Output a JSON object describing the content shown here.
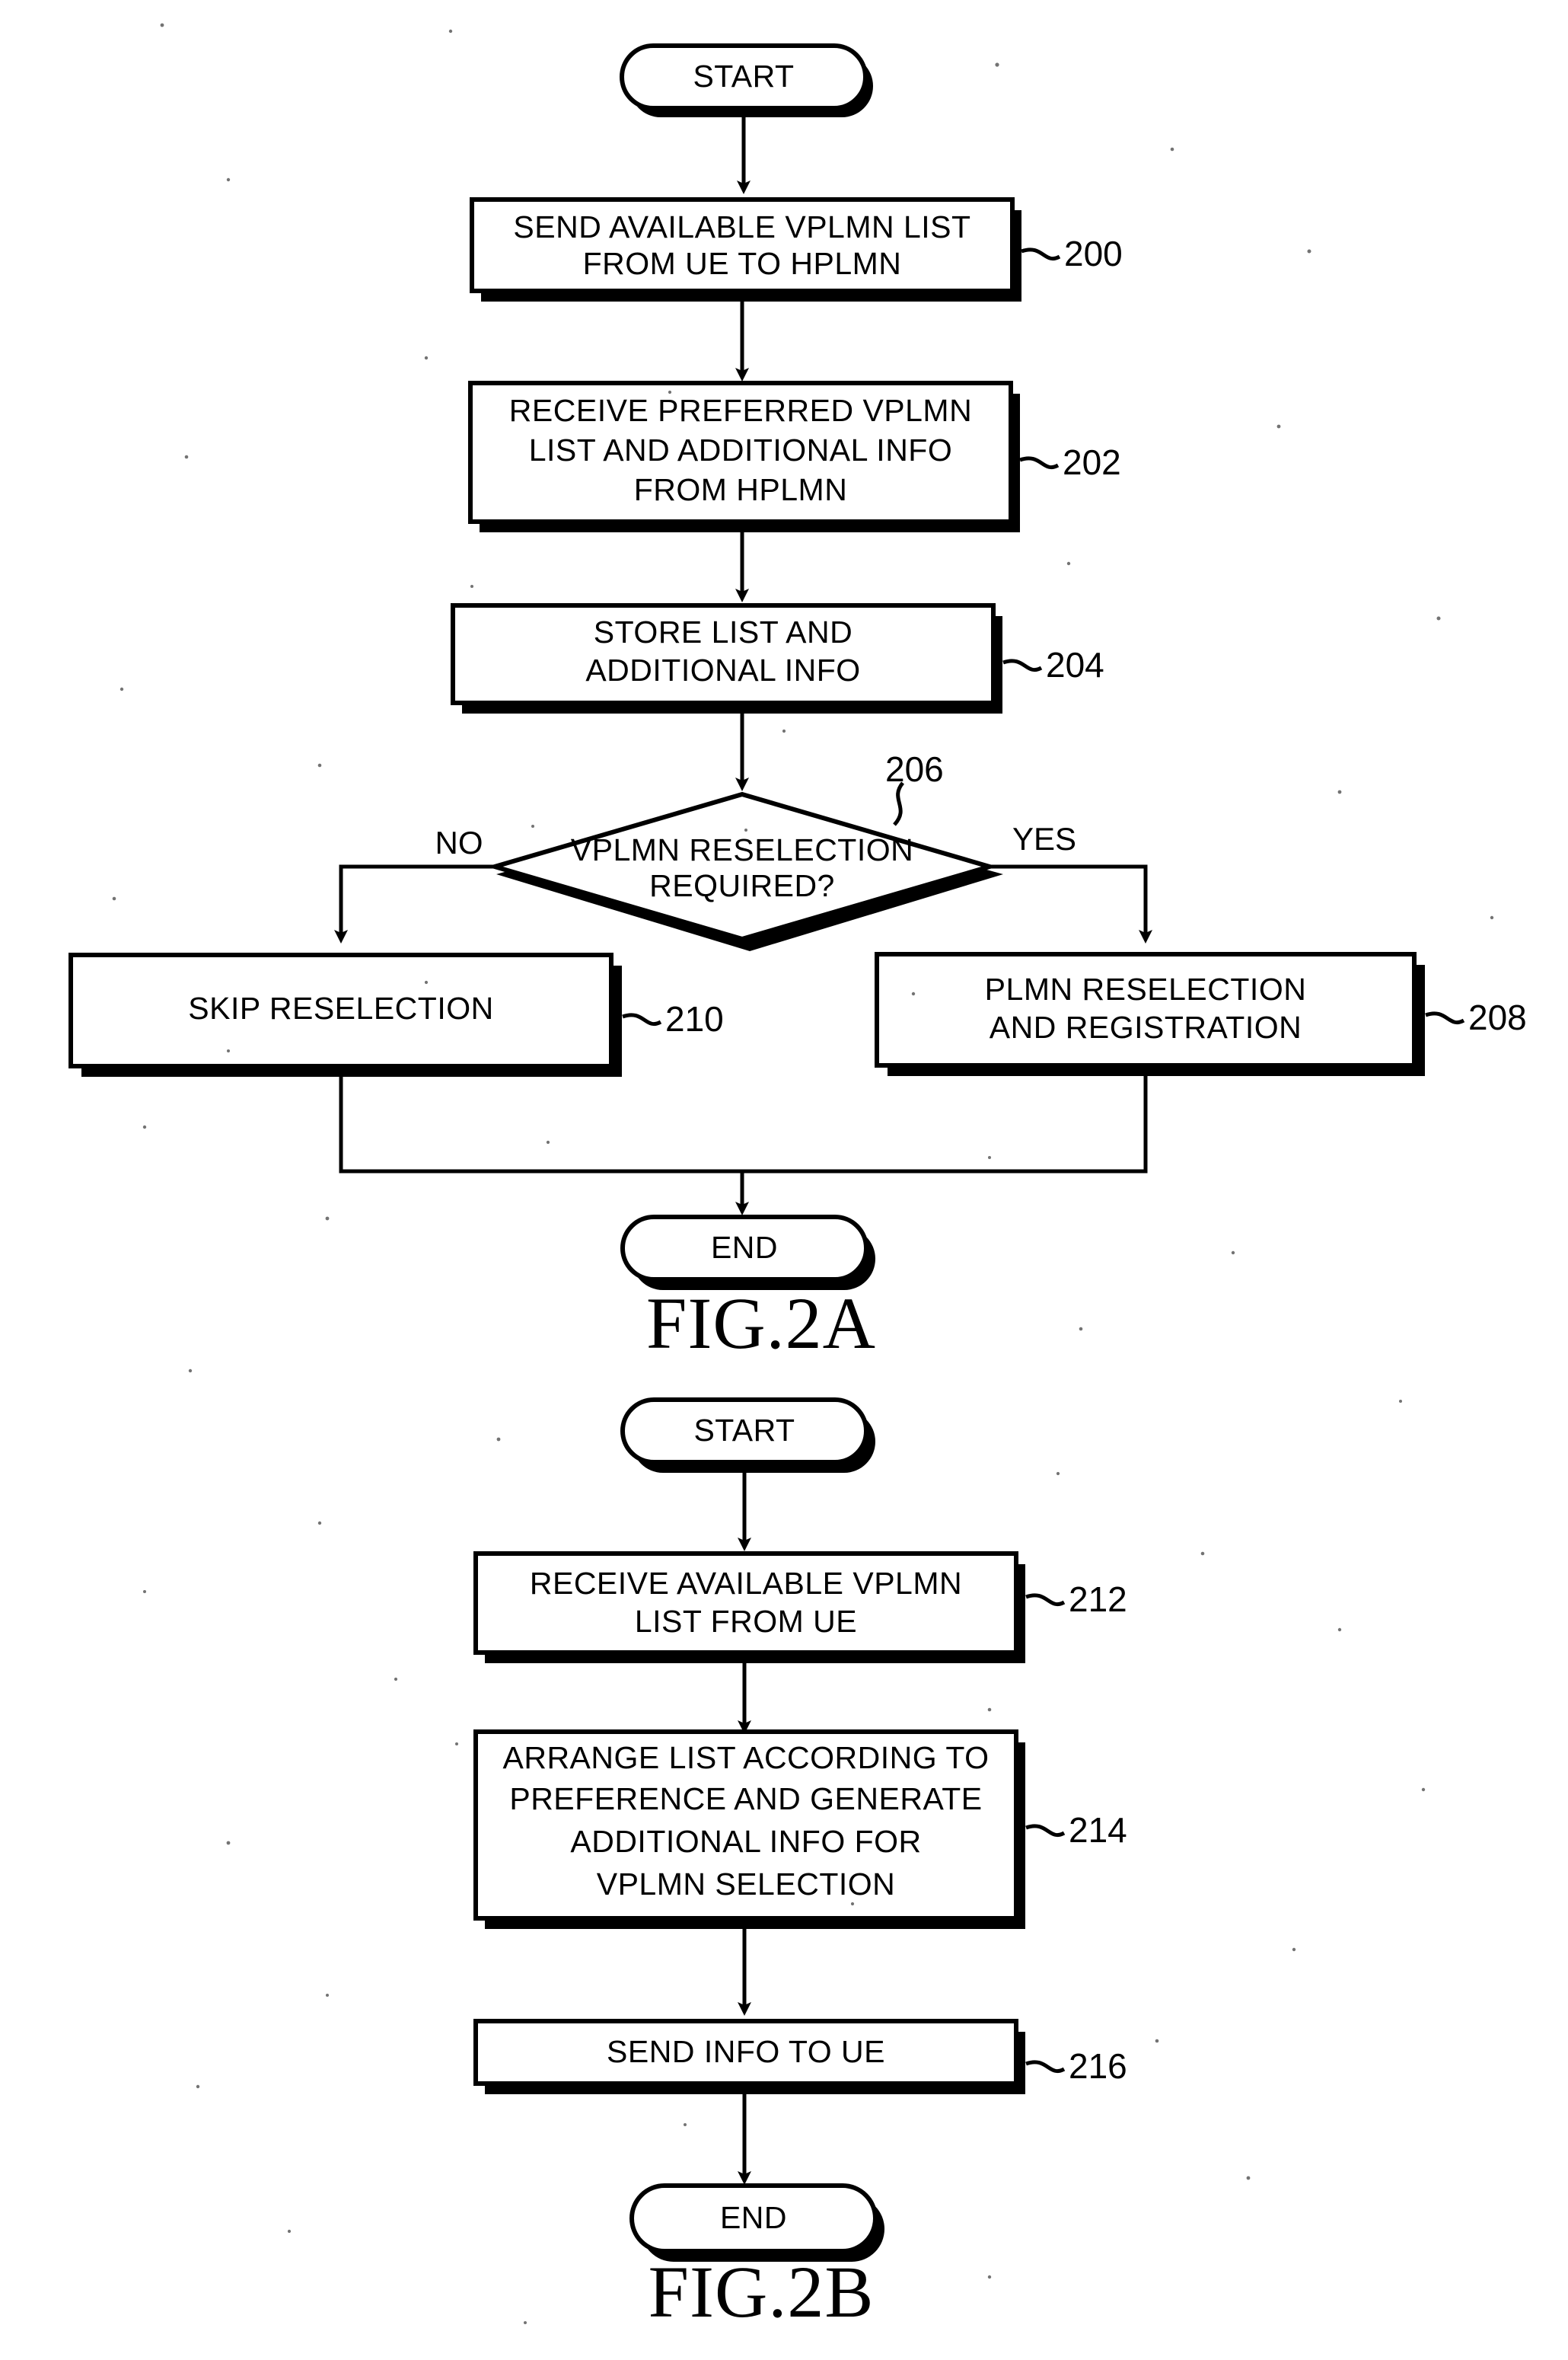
{
  "document": {
    "kind": "patent-flowchart-sheet",
    "figures": [
      {
        "caption": "FIG.2A",
        "nodes": {
          "start": {
            "label": "START"
          },
          "s200": {
            "ref": "200",
            "lines": [
              "SEND AVAILABLE VPLMN LIST",
              "FROM UE TO HPLMN"
            ]
          },
          "s202": {
            "ref": "202",
            "lines": [
              "RECEIVE PREFERRED VPLMN",
              "LIST AND ADDITIONAL INFO",
              "FROM HPLMN"
            ]
          },
          "s204": {
            "ref": "204",
            "lines": [
              "STORE LIST AND",
              "ADDITIONAL INFO"
            ]
          },
          "s206": {
            "ref": "206",
            "lines": [
              "VPLMN RESELECTION",
              "REQUIRED?"
            ],
            "branch_no": "NO",
            "branch_yes": "YES"
          },
          "s210": {
            "ref": "210",
            "lines": [
              "SKIP RESELECTION"
            ]
          },
          "s208": {
            "ref": "208",
            "lines": [
              "PLMN RESELECTION",
              "AND REGISTRATION"
            ]
          },
          "end": {
            "label": "END"
          }
        }
      },
      {
        "caption": "FIG.2B",
        "nodes": {
          "start": {
            "label": "START"
          },
          "s212": {
            "ref": "212",
            "lines": [
              "RECEIVE AVAILABLE VPLMN",
              "LIST FROM UE"
            ]
          },
          "s214": {
            "ref": "214",
            "lines": [
              "ARRANGE LIST ACCORDING TO",
              "PREFERENCE AND GENERATE",
              "ADDITIONAL INFO FOR",
              "VPLMN SELECTION"
            ]
          },
          "s216": {
            "ref": "216",
            "lines": [
              "SEND INFO TO UE"
            ]
          },
          "end": {
            "label": "END"
          }
        }
      }
    ]
  },
  "colors": {
    "ink": "#000000",
    "paper": "#ffffff"
  }
}
